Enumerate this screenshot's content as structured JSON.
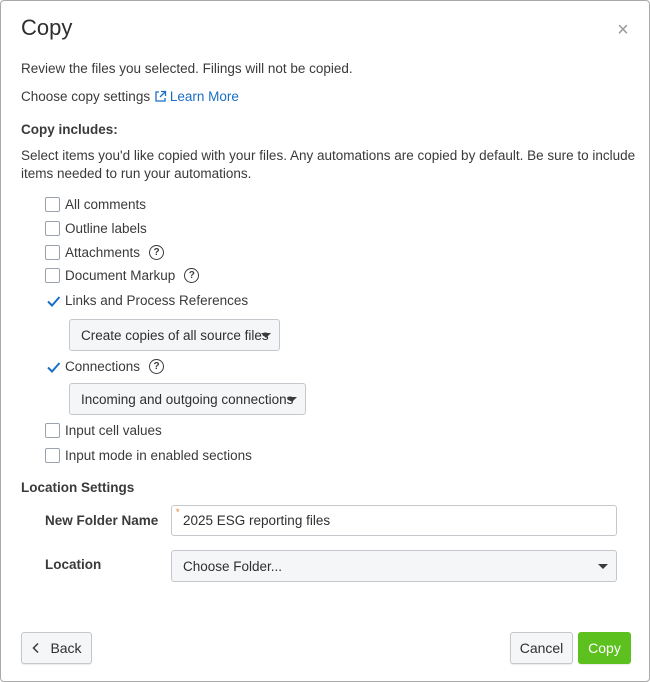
{
  "dialog": {
    "title": "Copy",
    "close_glyph": "×",
    "review_text": "Review the files you selected. Filings will not be copied.",
    "settings_text": "Choose copy settings",
    "learn_more": "Learn More",
    "includes_heading": "Copy includes:",
    "includes_description_line1": "Select items you'd like copied with your files. Any automations are copied by default. Be sure to include",
    "includes_description_line2": "items needed to run your automations."
  },
  "options": [
    {
      "label": "All comments",
      "checked": false
    },
    {
      "label": "Outline labels",
      "checked": false
    },
    {
      "label": "Attachments",
      "checked": false,
      "help": true
    },
    {
      "label": "Document Markup",
      "checked": false,
      "help": true
    },
    {
      "label": "Links and Process References",
      "checked": true
    },
    {
      "label": "Connections",
      "checked": true,
      "help": true
    },
    {
      "label": "Input cell values",
      "checked": false
    },
    {
      "label": "Input mode in enabled sections",
      "checked": false
    }
  ],
  "help_glyph": "?",
  "links_dropdown": {
    "selected": "Create copies of all source files"
  },
  "connections_dropdown": {
    "selected": "Incoming and outgoing connections"
  },
  "location": {
    "heading": "Location Settings",
    "folder_name_label": "New Folder Name",
    "folder_name_value": "2025 ESG reporting files",
    "required_marker": "*",
    "location_label": "Location",
    "location_selected": "Choose Folder..."
  },
  "footer": {
    "back_label": "Back",
    "cancel_label": "Cancel",
    "copy_label": "Copy"
  },
  "colors": {
    "accent": "#1a6fc4",
    "primary_button": "#5cc11e",
    "required": "#e2731c"
  }
}
